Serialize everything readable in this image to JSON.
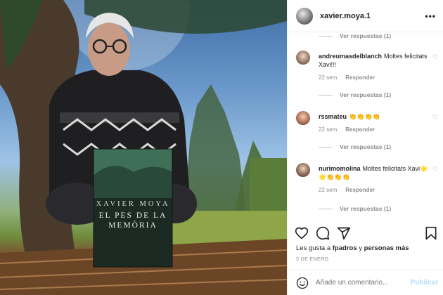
{
  "book": {
    "author": "XAVIER MOYA",
    "title_line1": "EL PES DE LA",
    "title_line2": "MEMÒRIA"
  },
  "header": {
    "username": "xavier.moya.1",
    "more_icon": "more-horizontal-icon"
  },
  "top_replies": "Ver respuestas (1)",
  "comments": [
    {
      "user": "andreumasdelblanch",
      "text": "Moltes felicitats Xavi!!!",
      "time": "22 sem",
      "reply": "Responder",
      "replies": "Ver respuestas (1)"
    },
    {
      "user": "rssmateu",
      "text": "👏👏👏👏",
      "time": "22 sem",
      "reply": "Responder",
      "replies": "Ver respuestas (1)"
    },
    {
      "user": "nurimomolina",
      "text": "Moltes felicitats Xavi🌟🌟👏👏👏",
      "time": "22 sem",
      "reply": "Responder",
      "replies": "Ver respuestas (1)"
    }
  ],
  "likes": {
    "prefix": "Les gusta a",
    "user": "fpadros",
    "connector": "y",
    "others": "personas más"
  },
  "date": "3 DE ENERO",
  "add_comment": {
    "placeholder": "Añade un comentario...",
    "publish": "Publicar"
  },
  "colors": {
    "text": "#262626",
    "secondary": "#8e8e8e",
    "publish_disabled": "#b2dffc",
    "border": "#efefef"
  }
}
